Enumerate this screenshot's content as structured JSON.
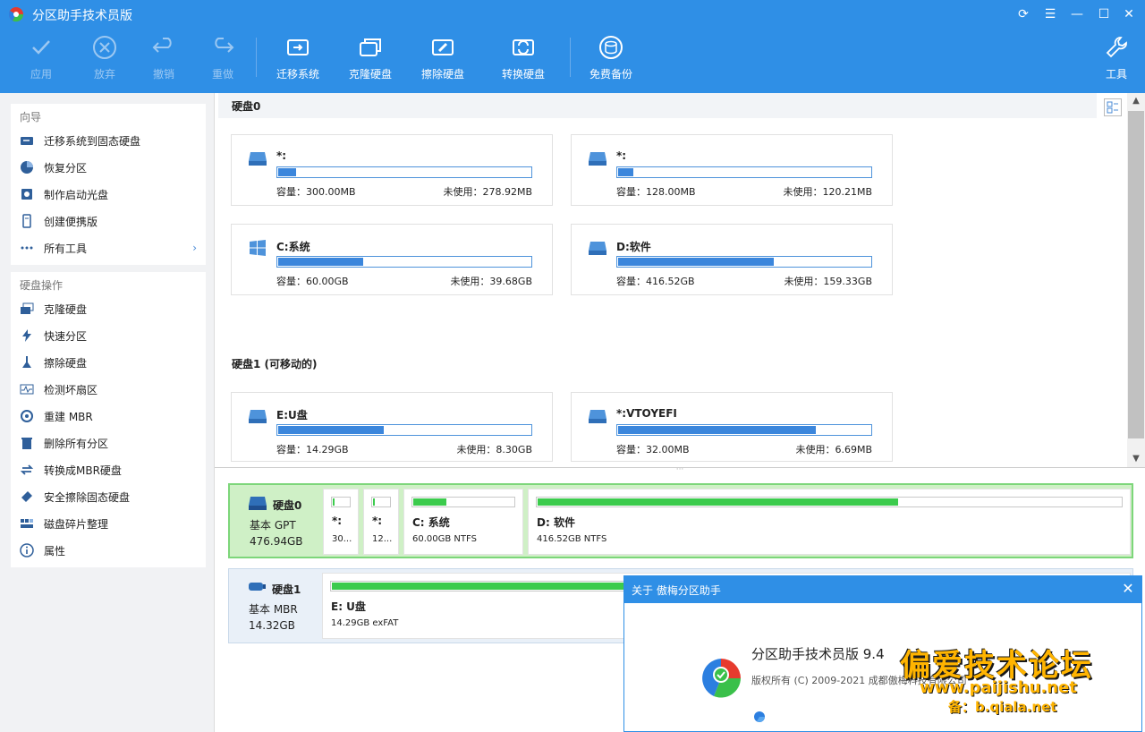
{
  "app": {
    "title": "分区助手技术员版"
  },
  "window_controls": [
    "refresh-icon",
    "menu-icon",
    "minimize-icon",
    "maximize-icon",
    "close-icon"
  ],
  "toolbar": {
    "apply": "应用",
    "discard": "放弃",
    "undo": "撤销",
    "redo": "重做",
    "migrate": "迁移系统",
    "clone": "克隆硬盘",
    "wipe": "擦除硬盘",
    "convert": "转换硬盘",
    "backup": "免费备份",
    "tools": "工具"
  },
  "wizard": {
    "title": "向导",
    "items": [
      "迁移系统到固态硬盘",
      "恢复分区",
      "制作启动光盘",
      "创建便携版",
      "所有工具"
    ]
  },
  "disk_ops": {
    "title": "硬盘操作",
    "items": [
      "克隆硬盘",
      "快速分区",
      "擦除硬盘",
      "检测坏扇区",
      "重建 MBR",
      "删除所有分区",
      "转换成MBR硬盘",
      "安全擦除固态硬盘",
      "磁盘碎片整理",
      "属性"
    ]
  },
  "disk0": {
    "header": "硬盘0",
    "cards": [
      {
        "name": "*:",
        "capacity": "容量：300.00MB",
        "free": "未使用：278.92MB",
        "used": 0.07,
        "icon": "drive-icon"
      },
      {
        "name": "*:",
        "capacity": "容量：128.00MB",
        "free": "未使用：120.21MB",
        "used": 0.06,
        "icon": "drive-icon"
      },
      {
        "name": "C:系统",
        "capacity": "容量：60.00GB",
        "free": "未使用：39.68GB",
        "used": 0.34,
        "icon": "windows-icon"
      },
      {
        "name": "D:软件",
        "capacity": "容量：416.52GB",
        "free": "未使用：159.33GB",
        "used": 0.62,
        "icon": "drive-icon"
      }
    ]
  },
  "disk1": {
    "header": "硬盘1 (可移动的)",
    "cards": [
      {
        "name": "E:U盘",
        "capacity": "容量：14.29GB",
        "free": "未使用：8.30GB",
        "used": 0.42,
        "icon": "drive-icon"
      },
      {
        "name": "*:VTOYEFI",
        "capacity": "容量：32.00MB",
        "free": "未使用：6.69MB",
        "used": 0.79,
        "icon": "drive-icon"
      }
    ]
  },
  "map": {
    "disk0": {
      "name": "硬盘0",
      "type": "基本 GPT",
      "size": "476.94GB",
      "parts": [
        {
          "name": "*:",
          "detail": "30...",
          "used": 0.07
        },
        {
          "name": "*:",
          "detail": "12...",
          "used": 0.06
        },
        {
          "name": "C: 系统",
          "detail": "60.00GB NTFS",
          "used": 0.34
        },
        {
          "name": "D: 软件",
          "detail": "416.52GB NTFS",
          "used": 0.62
        }
      ]
    },
    "disk1": {
      "name": "硬盘1",
      "type": "基本 MBR",
      "size": "14.32GB",
      "parts": [
        {
          "name": "E: U盘",
          "detail": "14.29GB exFAT",
          "used": 0.42
        }
      ]
    }
  },
  "about": {
    "title": "关于 傲梅分区助手",
    "name": "分区助手技术员版 9.4",
    "copyright": "版权所有 (C) 2009-2021 成都傲梅科技有限公司"
  },
  "watermark": {
    "line1": "偏爱技术论坛",
    "line2": "www.paijishu.net",
    "line3": "备：b.qiala.net"
  },
  "colors": {
    "brand": "#2f8fe6",
    "usage_bar": "#3b86dc",
    "map_bar": "#3ccb4d",
    "selected_row": "#cff0c6"
  }
}
